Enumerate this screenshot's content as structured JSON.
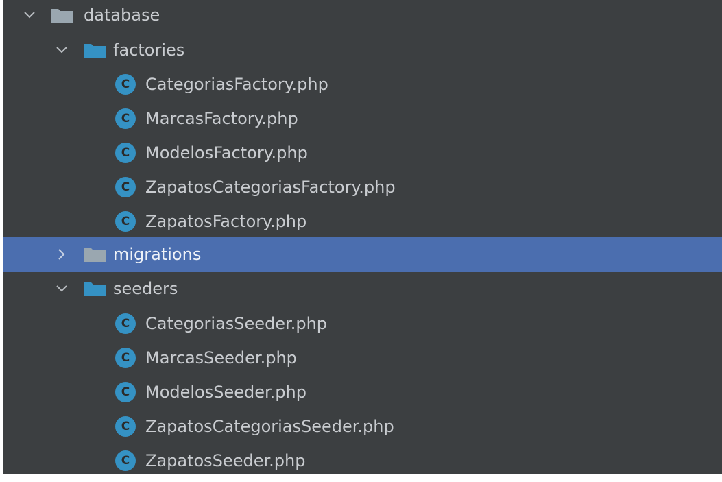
{
  "tree": {
    "root": {
      "label": "database",
      "expanded": true,
      "folder_color": "#9aa7b0"
    },
    "groups": [
      {
        "label": "factories",
        "expanded": true,
        "folder_color": "#3592c4",
        "files": [
          "CategoriasFactory.php",
          "MarcasFactory.php",
          "ModelosFactory.php",
          "ZapatosCategoriasFactory.php",
          "ZapatosFactory.php"
        ]
      },
      {
        "label": "migrations",
        "expanded": false,
        "selected": true,
        "folder_color": "#9aa7b0",
        "files": []
      },
      {
        "label": "seeders",
        "expanded": true,
        "folder_color": "#3592c4",
        "files": [
          "CategoriasSeeder.php",
          "MarcasSeeder.php",
          "ModelosSeeder.php",
          "ZapatosCategoriasSeeder.php",
          "ZapatosSeeder.php"
        ]
      }
    ],
    "file_icon": {
      "letter": "C",
      "name": "php-class-icon",
      "color": "#3592c4"
    },
    "colors": {
      "background": "#3c3f41",
      "selection": "#4b6eaf",
      "text": "#c9ccd0"
    }
  }
}
